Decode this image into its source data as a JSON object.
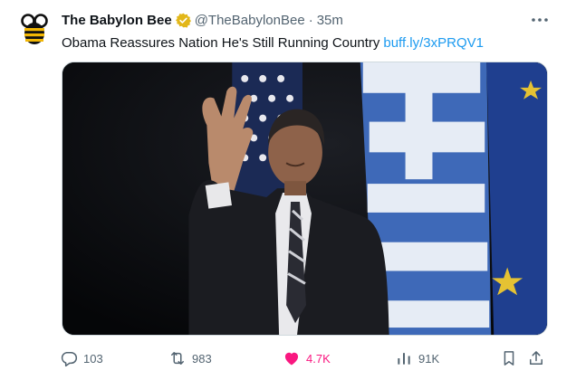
{
  "tweet": {
    "author_name": "The Babylon Bee",
    "handle": "@TheBabylonBee",
    "separator": "·",
    "time": "35m",
    "text": "Obama Reassures Nation He's Still Running Country",
    "link_text": "buff.ly/3xPRQV1",
    "verified_badge_icon": "gold-verified-badge-icon",
    "more_icon": "more-options-icon"
  },
  "actions": {
    "reply": {
      "icon": "reply-icon",
      "count": "103"
    },
    "retweet": {
      "icon": "retweet-icon",
      "count": "983"
    },
    "like": {
      "icon": "heart-icon",
      "count": "4.7K",
      "liked": true
    },
    "views": {
      "icon": "views-icon",
      "count": "91K"
    },
    "bookmark": {
      "icon": "bookmark-icon"
    },
    "share": {
      "icon": "share-icon"
    }
  },
  "colors": {
    "text": "#0f1419",
    "secondary": "#536471",
    "link": "#1d9bf0",
    "like_active": "#f91880",
    "verified_gold": "#e2b719"
  }
}
